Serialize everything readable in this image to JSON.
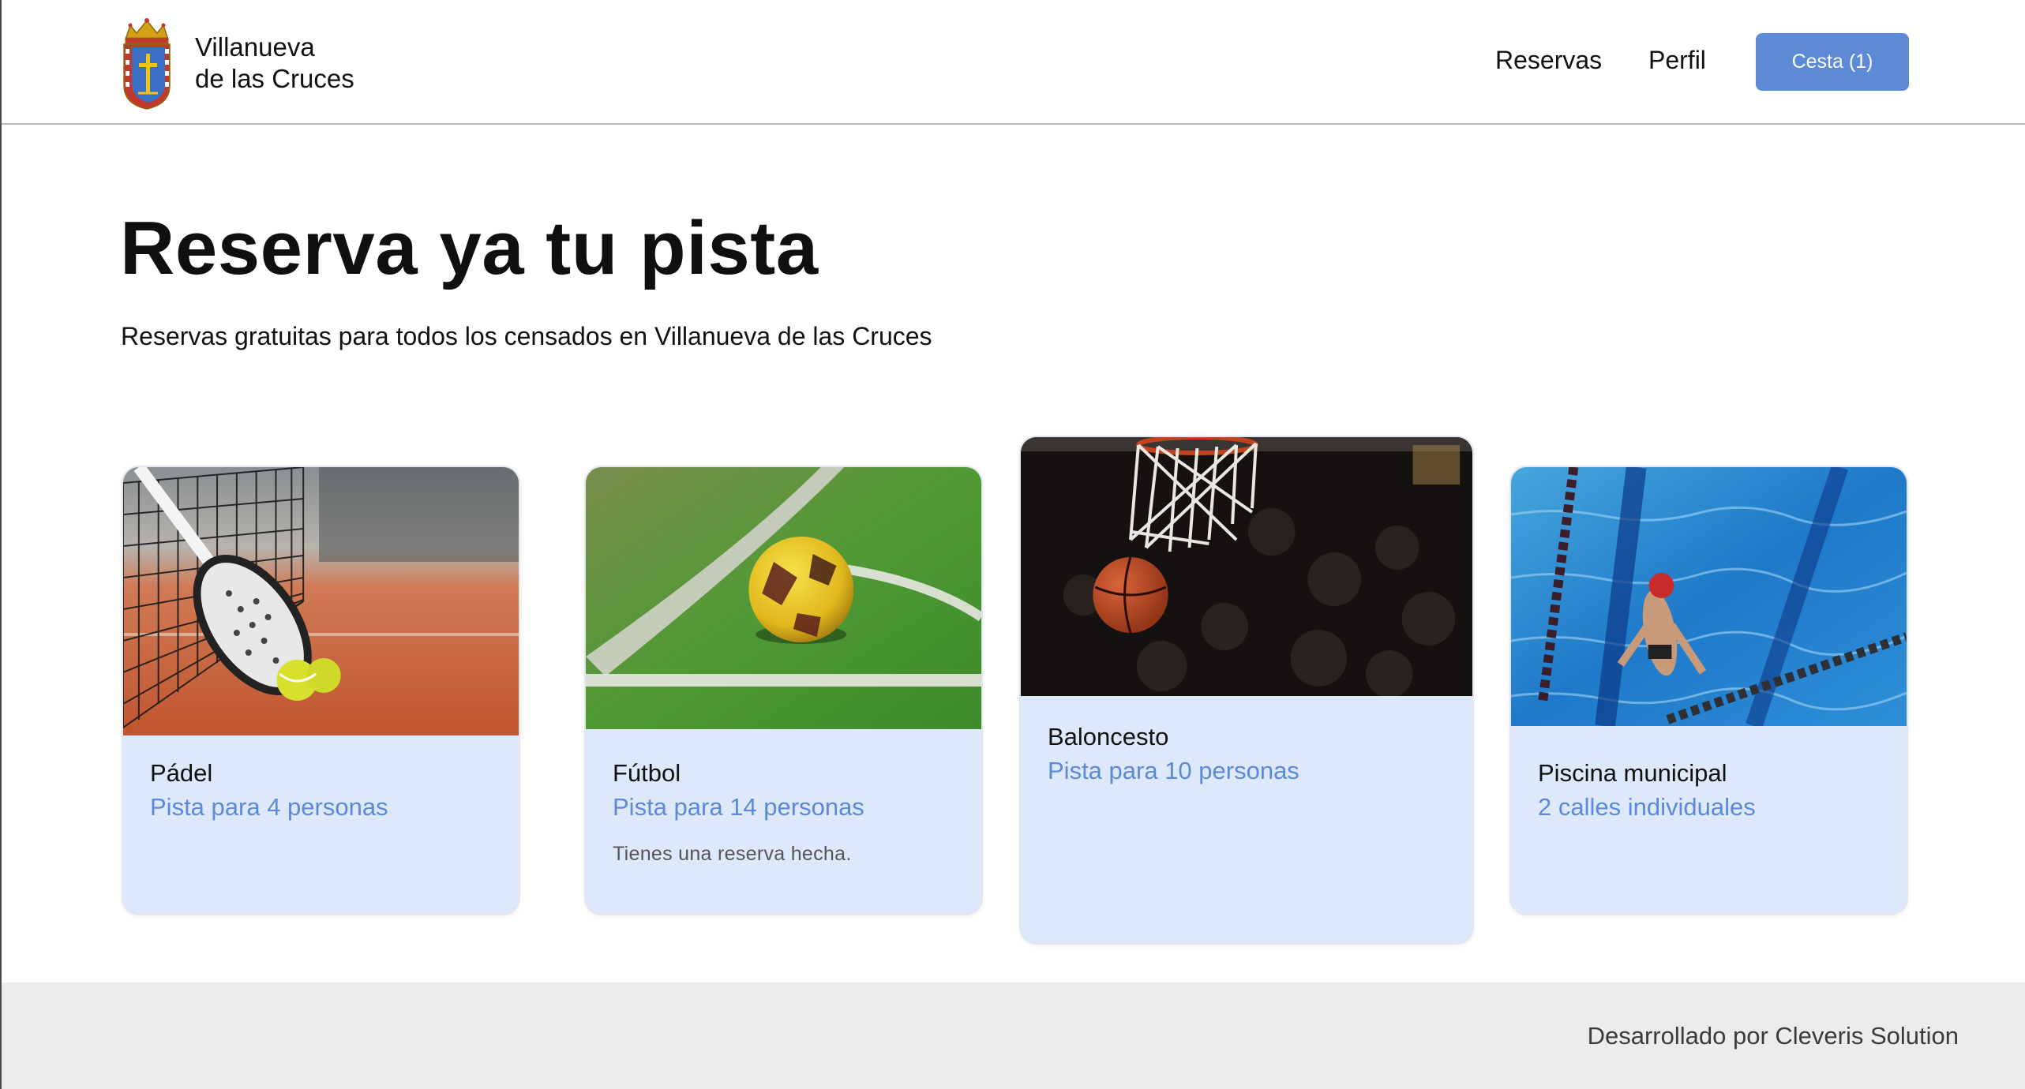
{
  "header": {
    "brand": {
      "line1": "Villanueva",
      "line2": "de las Cruces",
      "logo_icon": "coat-of-arms-icon"
    },
    "nav": {
      "reservas_label": "Reservas",
      "perfil_label": "Perfil",
      "cart_label": "Cesta (1)"
    }
  },
  "hero": {
    "title": "Reserva ya tu pista",
    "subtitle": "Reservas gratuitas para todos los censados en Villanueva de las Cruces"
  },
  "cards": [
    {
      "title": "Pádel",
      "subtitle": "Pista para 4 personas",
      "note": "",
      "image": "padel-court-photo"
    },
    {
      "title": "Fútbol",
      "subtitle": "Pista para 14 personas",
      "note": "Tienes una reserva hecha.",
      "image": "football-pitch-photo"
    },
    {
      "title": "Baloncesto",
      "subtitle": "Pista para 10 personas",
      "note": "",
      "image": "basketball-hoop-photo"
    },
    {
      "title": "Piscina municipal",
      "subtitle": "2 calles individuales",
      "note": "",
      "image": "swimming-pool-photo"
    }
  ],
  "footer": {
    "text": "Desarrollado por Cleveris Solution"
  },
  "colors": {
    "accent": "#5c8ad7",
    "card_background": "#dde8fb",
    "footer_background": "#ececec"
  }
}
